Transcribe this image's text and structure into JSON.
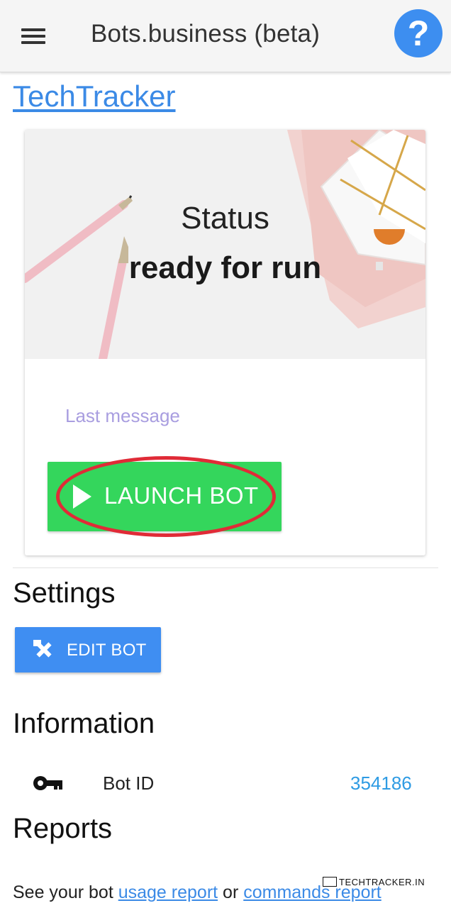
{
  "appbar": {
    "title": "Bots.business (beta)",
    "help_symbol": "?",
    "icons": {
      "menu": "hamburger-menu-icon",
      "help": "question-mark-icon"
    }
  },
  "bot": {
    "name": "TechTracker"
  },
  "status_card": {
    "status_label": "Status",
    "status_value": "ready for run",
    "last_message_label": "Last message",
    "launch_button_label": "LAUNCH BOT",
    "launch_icon": "play-icon",
    "accent_color": "#34d65c",
    "highlight_color": "#e02b37"
  },
  "settings": {
    "title": "Settings",
    "edit_button_label": "EDIT BOT",
    "edit_icon": "tools-icon",
    "button_color": "#3f8ef2"
  },
  "information": {
    "title": "Information",
    "rows": [
      {
        "icon": "key-icon",
        "label": "Bot ID",
        "value": "354186"
      }
    ]
  },
  "reports": {
    "title": "Reports",
    "text_before": "See your bot ",
    "usage_link": "usage report",
    "text_between": " or ",
    "commands_link": "commands report"
  },
  "watermark": {
    "text": "TECHTRACKER.IN"
  }
}
